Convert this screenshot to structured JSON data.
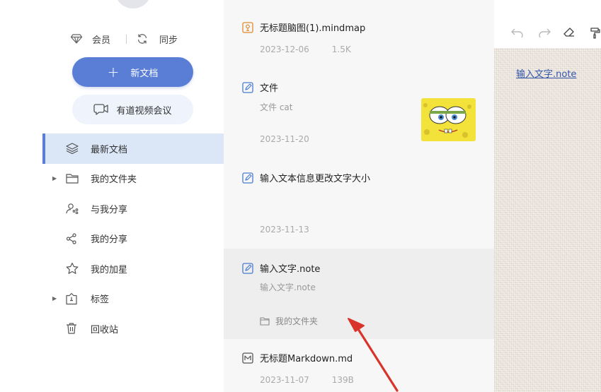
{
  "sidebar": {
    "member_label": "会员",
    "sync_label": "同步",
    "new_doc_label": "新文档",
    "meeting_label": "有道视频会议",
    "items": [
      {
        "label": "最新文档",
        "icon": "layers-icon",
        "active": true
      },
      {
        "label": "我的文件夹",
        "icon": "folder-icon",
        "expandable": true
      },
      {
        "label": "与我分享",
        "icon": "shared-with-me-icon"
      },
      {
        "label": "我的分享",
        "icon": "share-icon"
      },
      {
        "label": "我的加星",
        "icon": "star-icon"
      },
      {
        "label": "标签",
        "icon": "tag-icon",
        "expandable": true
      },
      {
        "label": "回收站",
        "icon": "trash-icon"
      }
    ]
  },
  "files": [
    {
      "title": "无标题脑图(1).mindmap",
      "icon": "mindmap-icon",
      "date": "2023-12-06",
      "size": "1.5K"
    },
    {
      "title": "文件",
      "icon": "note-icon",
      "preview": "文件 cat",
      "date": "2023-11-20",
      "has_thumbnail": true
    },
    {
      "title": "输入文本信息更改文字大小",
      "icon": "note-icon",
      "date": "2023-11-13"
    },
    {
      "title": "输入文字.note",
      "icon": "note-icon",
      "preview": "输入文字.note",
      "folder": "我的文件夹",
      "selected": true
    },
    {
      "title": "无标题Markdown.md",
      "icon": "markdown-icon",
      "date": "2023-11-07",
      "size": "139B"
    }
  ],
  "editor": {
    "note_link": "输入文字.note"
  },
  "colors": {
    "accent": "#5a7ed6",
    "active_bg": "#dbe6f7",
    "arrow": "#d9342b"
  }
}
